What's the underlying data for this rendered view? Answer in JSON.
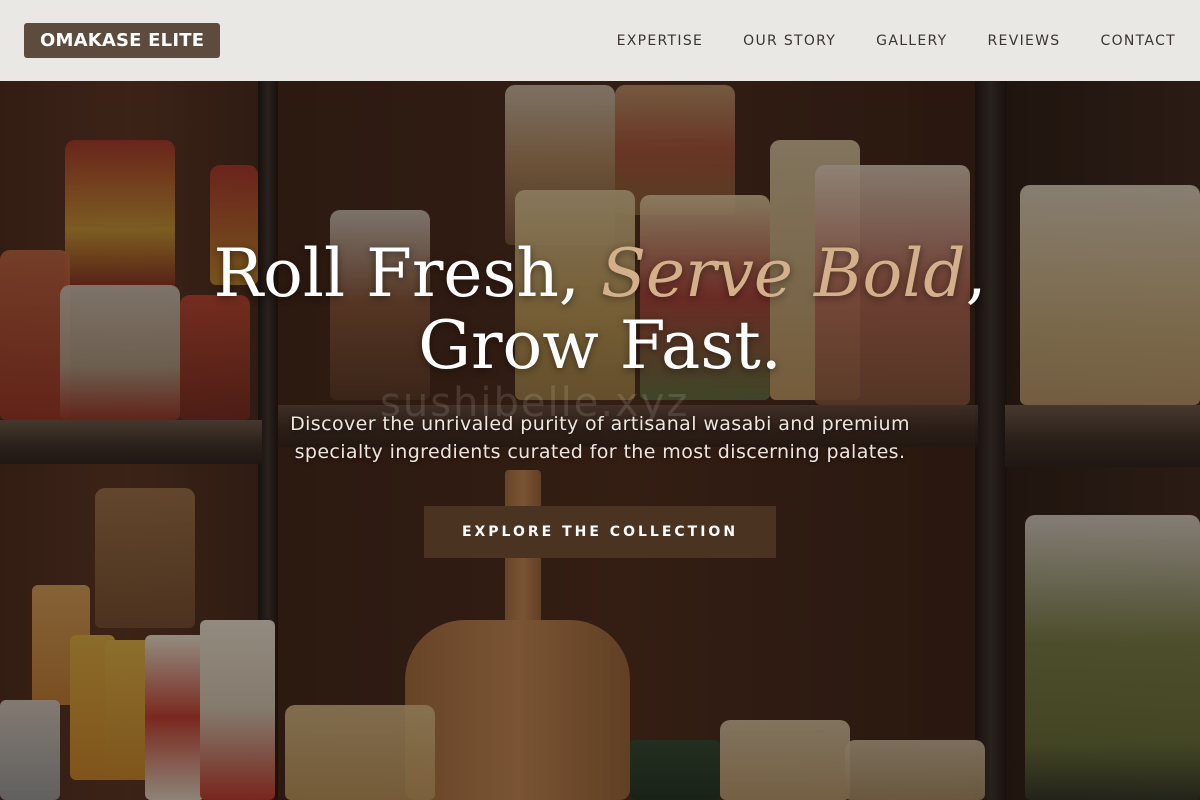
{
  "brand": {
    "logo_text": "OMAKASE ELITE"
  },
  "nav": {
    "items": [
      {
        "label": "EXPERTISE"
      },
      {
        "label": "OUR STORY"
      },
      {
        "label": "GALLERY"
      },
      {
        "label": "REVIEWS"
      },
      {
        "label": "CONTACT"
      }
    ]
  },
  "hero": {
    "headline_part1": "Roll Fresh, ",
    "headline_accent": "Serve Bold",
    "headline_part2": ",",
    "headline_line2": "Grow Fast.",
    "watermark": "sushibelle.xyz",
    "subtitle": "Discover the unrivaled purity of artisanal wasabi and premium specialty ingredients curated for the most discerning palates.",
    "cta_label": "EXPLORE THE COLLECTION",
    "background_image": "pantry-shelves-with-pasta-bags-photo"
  },
  "colors": {
    "logo_bg": "#5d4c3d",
    "header_bg": "#f2f0ee",
    "accent_text": "#d4b08a",
    "cta_bg": "#4b3322"
  }
}
